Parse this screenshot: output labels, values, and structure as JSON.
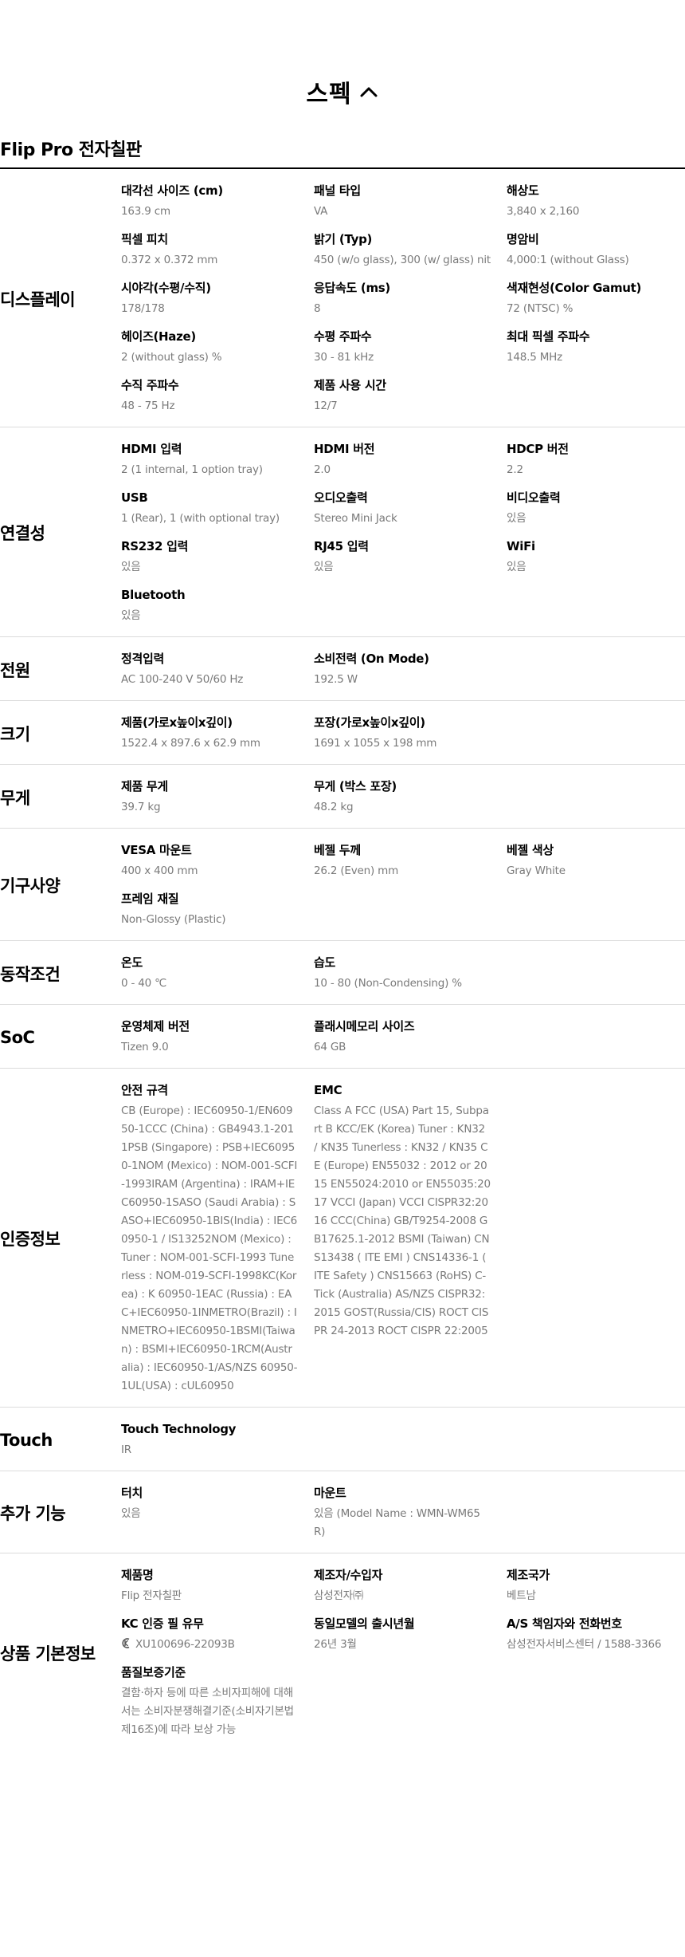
{
  "spec": {
    "title": "스펙"
  },
  "product": {
    "name": "Flip Pro 전자칠판"
  },
  "sections": [
    {
      "title": "디스플레이",
      "items": [
        {
          "label": "대각선 사이즈 (cm)",
          "value": "163.9 cm"
        },
        {
          "label": "패널 타입",
          "value": "VA"
        },
        {
          "label": "해상도",
          "value": "3,840 x 2,160"
        },
        {
          "label": "픽셀 피치",
          "value": "0.372 x 0.372 mm"
        },
        {
          "label": "밝기 (Typ)",
          "value": "450 (w/o glass), 300 (w/ glass) nit"
        },
        {
          "label": "명암비",
          "value": "4,000:1 (without Glass)"
        },
        {
          "label": "시야각(수평/수직)",
          "value": "178/178"
        },
        {
          "label": "응답속도 (ms)",
          "value": "8"
        },
        {
          "label": "색재현성(Color Gamut)",
          "value": "72 (NTSC) %"
        },
        {
          "label": "헤이즈(Haze)",
          "value": "2 (without glass) %"
        },
        {
          "label": "수평 주파수",
          "value": "30 - 81 kHz"
        },
        {
          "label": "최대 픽셀 주파수",
          "value": "148.5 MHz"
        },
        {
          "label": "수직 주파수",
          "value": "48 - 75 Hz"
        },
        {
          "label": "제품 사용 시간",
          "value": "12/7"
        }
      ]
    },
    {
      "title": "연결성",
      "items": [
        {
          "label": "HDMI 입력",
          "value": "2 (1 internal, 1 option tray)"
        },
        {
          "label": "HDMI 버전",
          "value": "2.0"
        },
        {
          "label": "HDCP 버전",
          "value": "2.2"
        },
        {
          "label": "USB",
          "value": "1 (Rear), 1 (with optional tray)"
        },
        {
          "label": "오디오출력",
          "value": "Stereo Mini Jack"
        },
        {
          "label": "비디오출력",
          "value": "있음"
        },
        {
          "label": "RS232 입력",
          "value": "있음"
        },
        {
          "label": "RJ45 입력",
          "value": "있음"
        },
        {
          "label": "WiFi",
          "value": "있음"
        },
        {
          "label": "Bluetooth",
          "value": "있음"
        }
      ]
    },
    {
      "title": "전원",
      "items": [
        {
          "label": "정격입력",
          "value": "AC 100-240 V 50/60 Hz"
        },
        {
          "label": "소비전력 (On Mode)",
          "value": "192.5 W"
        }
      ]
    },
    {
      "title": "크기",
      "items": [
        {
          "label": "제품(가로x높이x깊이)",
          "value": "1522.4 x 897.6 x 62.9 mm"
        },
        {
          "label": "포장(가로x높이x깊이)",
          "value": "1691 x 1055 x 198 mm"
        }
      ]
    },
    {
      "title": "무게",
      "items": [
        {
          "label": "제품 무게",
          "value": "39.7 kg"
        },
        {
          "label": "무게 (박스 포장)",
          "value": "48.2 kg"
        }
      ]
    },
    {
      "title": "기구사양",
      "items": [
        {
          "label": "VESA 마운트",
          "value": "400 x 400 mm"
        },
        {
          "label": "베젤 두께",
          "value": "26.2 (Even) mm"
        },
        {
          "label": "베젤 색상",
          "value": "Gray White"
        },
        {
          "label": "프레임 재질",
          "value": "Non-Glossy (Plastic)"
        }
      ]
    },
    {
      "title": "동작조건",
      "items": [
        {
          "label": "온도",
          "value": "0 - 40 ℃"
        },
        {
          "label": "습도",
          "value": "10 - 80 (Non-Condensing) %"
        }
      ]
    },
    {
      "title": "SoC",
      "items": [
        {
          "label": "운영체제 버전",
          "value": "Tizen 9.0"
        },
        {
          "label": "플래시메모리 사이즈",
          "value": "64 GB"
        }
      ]
    },
    {
      "title": "인증정보",
      "items": [
        {
          "label": "안전 규격",
          "value": "CB (Europe) : IEC60950-1/EN60950-1CCC (China) : GB4943.1-2011PSB (Singapore) : PSB+IEC60950-1NOM (Mexico) : NOM-001-SCFI-1993IRAM (Argentina) : IRAM+IEC60950-1SASO (Saudi Arabia) : SASO+IEC60950-1BIS(India) : IEC60950-1 / IS13252NOM (Mexico) : Tuner : NOM-001-SCFI-1993 Tunerless : NOM-019-SCFI-1998KC(Korea) : K 60950-1EAC (Russia) : EAC+IEC60950-1INMETRO(Brazil) : INMETRO+IEC60950-1BSMI(Taiwan) : BSMI+IEC60950-1RCM(Australia) : IEC60950-1/AS/NZS 60950-1UL(USA) : cUL60950"
        },
        {
          "label": "EMC",
          "value": "Class A FCC (USA) Part 15, Subpart B KCC/EK (Korea) Tuner : KN32 / KN35      Tunerless : KN32 / KN35 CE (Europe) EN55032 : 2012 or 2015      EN55024:2010 or EN55035:2017 VCCI (Japan) VCCI CISPR32:2016      CCC(China) GB/T9254-2008      GB17625.1-2012 BSMI (Taiwan) CNS13438 ( ITE EMI ) CNS14336-1 ( ITE Safety ) CNS15663 (RoHS)      C-Tick (Australia) AS/NZS CISPR32:2015      GOST(Russia/CIS) ROCT CISPR 24-2013      ROCT CISPR 22:2005"
        }
      ]
    },
    {
      "title": "Touch",
      "items": [
        {
          "label": "Touch Technology",
          "value": "IR"
        }
      ]
    },
    {
      "title": "추가 기능",
      "items": [
        {
          "label": "터치",
          "value": "있음"
        },
        {
          "label": "마운트",
          "value": "있음 (Model Name : WMN-WM65R)"
        }
      ]
    },
    {
      "title": "상품 기본정보",
      "items": [
        {
          "label": "제품명",
          "value": "Flip 전자칠판"
        },
        {
          "label": "제조자/수입자",
          "value": "삼성전자㈜"
        },
        {
          "label": "제조국가",
          "value": "베트남"
        },
        {
          "label": "KC 인증 필 유무",
          "value": "XU100696-22093B",
          "kc": true
        },
        {
          "label": "동일모델의 출시년월",
          "value": "26년 3월"
        },
        {
          "label": "A/S 책임자와 전화번호",
          "value": "삼성전자서비스센터 / 1588-3366"
        },
        {
          "label": "품질보증기준",
          "value": "결함·하자 등에 따른 소비자피해에 대해서는 소비자분쟁해결기준(소비자기본법 제16조)에 따라 보상 가능"
        }
      ]
    }
  ]
}
